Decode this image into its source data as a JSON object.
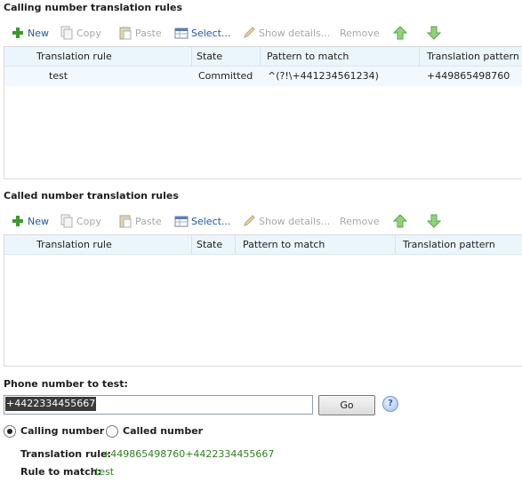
{
  "calling": {
    "title": "Calling number translation rules",
    "toolbar": {
      "new": "New",
      "copy": "Copy",
      "paste": "Paste",
      "select": "Select...",
      "show_details": "Show details...",
      "remove": "Remove"
    },
    "columns": [
      "Translation rule",
      "State",
      "Pattern to match",
      "Translation pattern"
    ],
    "rows": [
      {
        "rule": "test",
        "state": "Committed",
        "pattern": "^(?!\\+441234561234)",
        "translation": "+449865498760"
      }
    ]
  },
  "called": {
    "title": "Called number translation rules",
    "toolbar": {
      "new": "New",
      "copy": "Copy",
      "paste": "Paste",
      "select": "Select...",
      "show_details": "Show details...",
      "remove": "Remove"
    },
    "columns": [
      "Translation rule",
      "State",
      "Pattern to match",
      "Translation pattern"
    ],
    "rows": []
  },
  "test": {
    "label": "Phone number to test:",
    "value": "+4422334455667",
    "go": "Go",
    "help": "?",
    "radio_calling": "Calling number",
    "radio_called": "Called number",
    "selected": "calling",
    "result_label": "Translation rule:",
    "result_value": "+449865498760+4422334455667",
    "match_label": "Rule to match:",
    "match_value": "test"
  },
  "colors": {
    "link_blue": "#1a5aa6",
    "disabled_gray": "#a8a8a8",
    "header_bg": "#ebf5fc",
    "result_green": "#2f7f1f"
  }
}
